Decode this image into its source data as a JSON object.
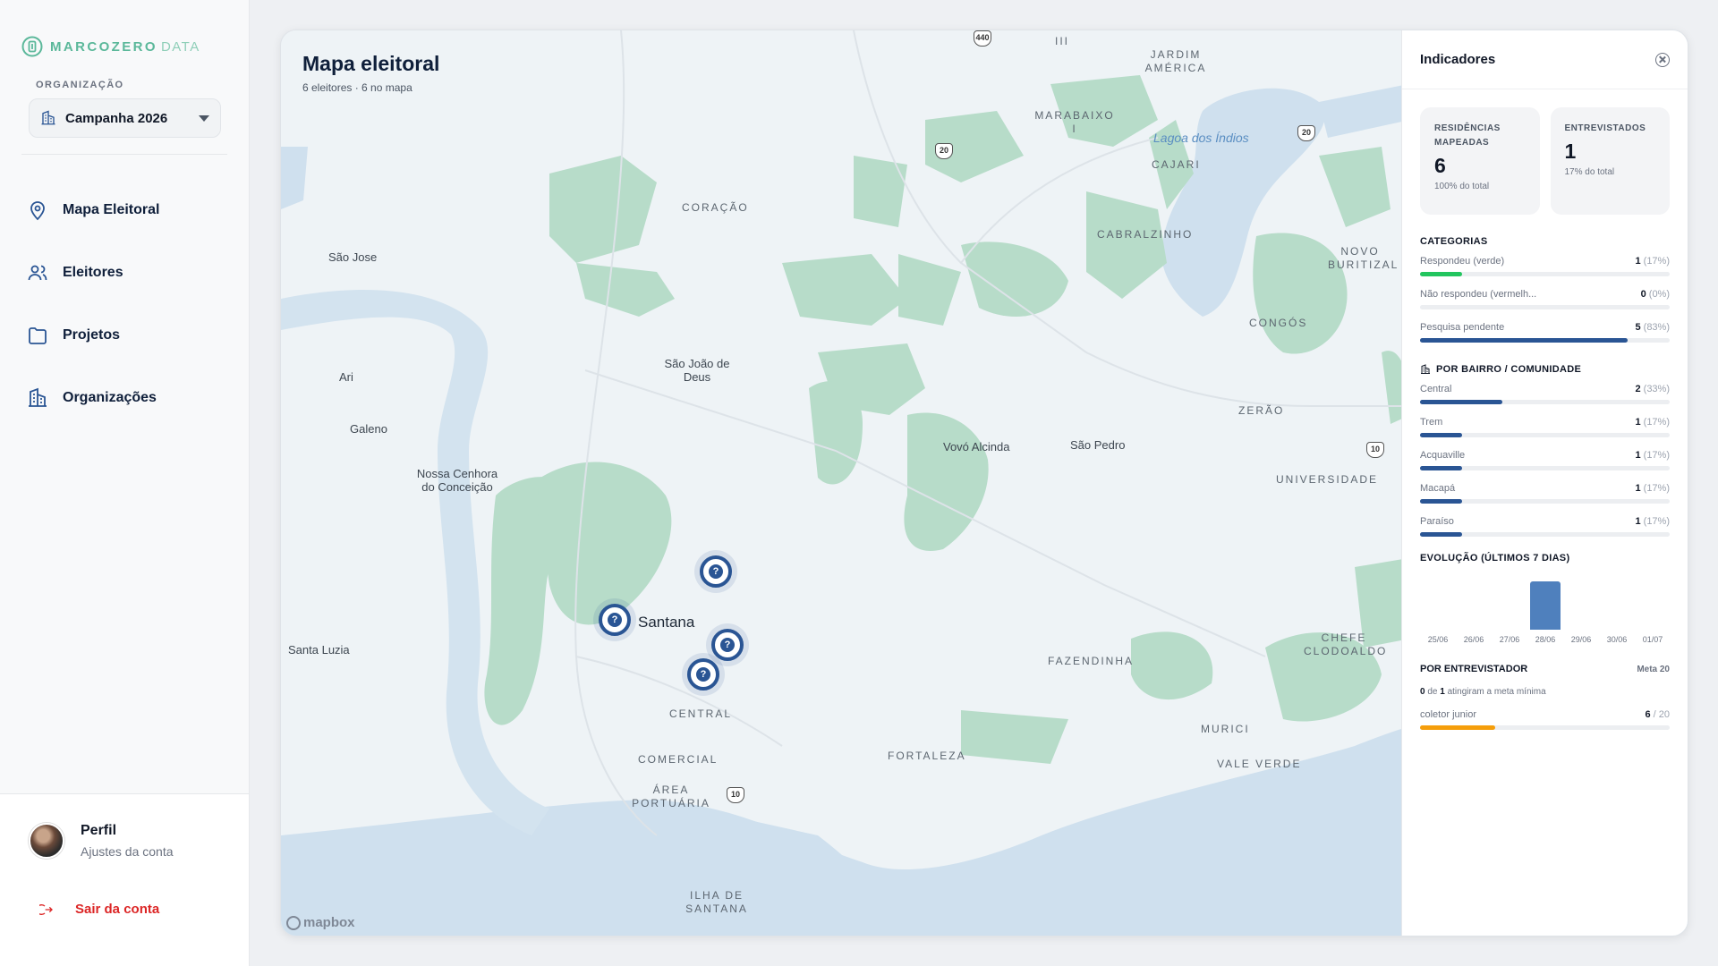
{
  "brand": {
    "name": "MARCOZERO",
    "sub": "DATA"
  },
  "sidebar": {
    "org_label": "ORGANIZAÇÃO",
    "org_selected": "Campanha 2026",
    "nav": [
      {
        "label": "Mapa Eleitoral",
        "icon": "map-pin-icon"
      },
      {
        "label": "Eleitores",
        "icon": "users-icon"
      },
      {
        "label": "Projetos",
        "icon": "folder-icon"
      },
      {
        "label": "Organizações",
        "icon": "building-icon"
      }
    ],
    "profile": {
      "name": "Perfil",
      "hint": "Ajustes da conta"
    },
    "logout": "Sair da conta"
  },
  "map": {
    "title": "Mapa eleitoral",
    "subtitle": "6 eleitores · 6 no mapa",
    "attribution": "mapbox",
    "places": [
      "São Jose",
      "Ari",
      "Galeno",
      "Nossa Cenhora do Conceição",
      "Santa Luzia",
      "CORAÇÃO",
      "São João de Deus",
      "Santana",
      "CENTRAL",
      "COMERCIAL",
      "ÁREA PORTUÁRIA",
      "ILHA DE SANTANA",
      "Vovó Alcinda",
      "São Pedro",
      "FAZENDINHA",
      "FORTALEZA",
      "MURICI",
      "VALE VERDE",
      "CHEFE CLODOALDO",
      "UNIVERSIDADE",
      "ZERÃO",
      "CONGÓS",
      "NOVO BURITIZAL",
      "CABRALZINHO",
      "CAJARI",
      "MARABAIXO I",
      "JARDIM AMÉRICA",
      "Lagoa dos Índios",
      "III"
    ],
    "road_shields": [
      "440",
      "20",
      "20",
      "10",
      "10"
    ]
  },
  "indicators": {
    "title": "Indicadores",
    "stats": [
      {
        "label": "RESIDÊNCIAS MAPEADAS",
        "value": "6",
        "pct": "100% do total"
      },
      {
        "label": "ENTREVISTADOS",
        "value": "1",
        "pct": "17% do total"
      }
    ],
    "categories_title": "CATEGORIAS",
    "categories": [
      {
        "label": "Respondeu (verde)",
        "count": "1",
        "pct": "(17%)",
        "fraction": 0.17,
        "color": "#22c55e"
      },
      {
        "label": "Não respondeu (vermelh...",
        "count": "0",
        "pct": "(0%)",
        "fraction": 0.0,
        "color": "#ef4444"
      },
      {
        "label": "Pesquisa pendente",
        "count": "5",
        "pct": "(83%)",
        "fraction": 0.83,
        "color": "#2a5594"
      }
    ],
    "bairro_title": "POR BAIRRO / COMUNIDADE",
    "bairros": [
      {
        "label": "Central",
        "count": "2",
        "pct": "(33%)",
        "fraction": 0.33
      },
      {
        "label": "Trem",
        "count": "1",
        "pct": "(17%)",
        "fraction": 0.17
      },
      {
        "label": "Acquaville",
        "count": "1",
        "pct": "(17%)",
        "fraction": 0.17
      },
      {
        "label": "Macapá",
        "count": "1",
        "pct": "(17%)",
        "fraction": 0.17
      },
      {
        "label": "Paraíso",
        "count": "1",
        "pct": "(17%)",
        "fraction": 0.17
      }
    ],
    "evolution_title": "EVOLUÇÃO (ÚLTIMOS 7 DIAS)",
    "evolution": {
      "days": [
        "25/06",
        "26/06",
        "27/06",
        "28/06",
        "29/06",
        "30/06",
        "01/07"
      ],
      "values": [
        0,
        0,
        0,
        1,
        0,
        0,
        0
      ]
    },
    "interviewer_title": "POR ENTREVISTADOR",
    "interviewer_meta": "Meta 20",
    "interviewer_note": {
      "achieved": "0",
      "of": "de",
      "total": "1",
      "rest": "atingiram a meta mínima"
    },
    "interviewers": [
      {
        "name": "coletor junior",
        "count": "6",
        "goal": "/ 20",
        "fraction": 0.3,
        "color": "#f59e0b"
      }
    ]
  }
}
